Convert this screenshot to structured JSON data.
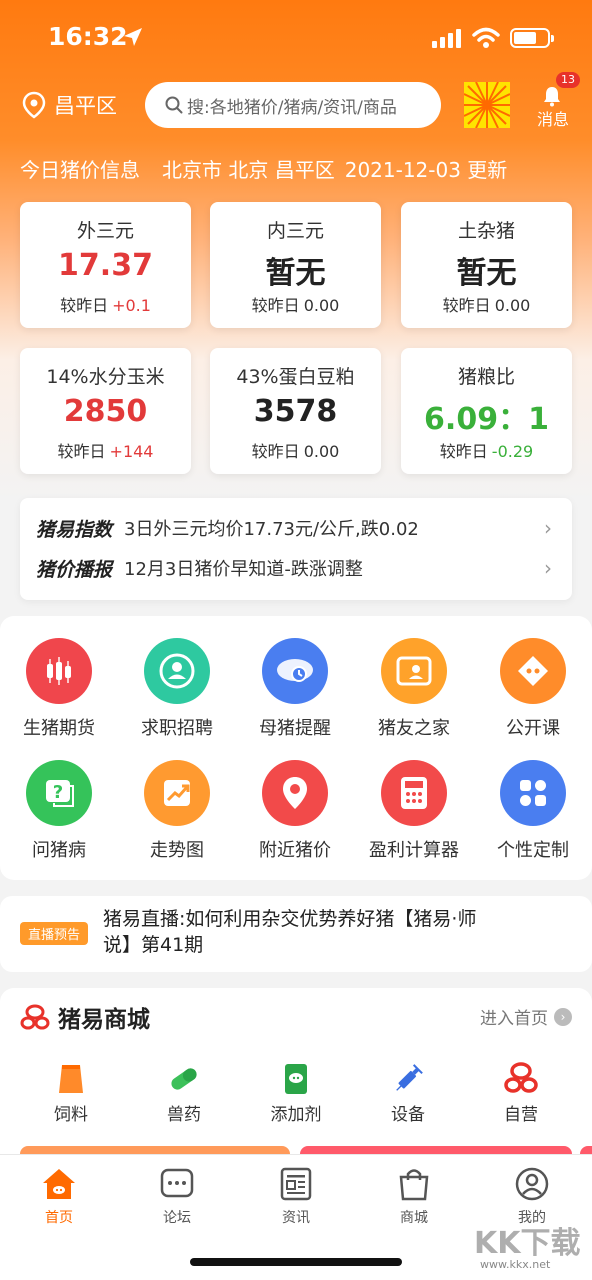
{
  "status_bar": {
    "time": "16:32"
  },
  "header": {
    "location": "昌平区",
    "search_placeholder": "搜:各地猪价/猪病/资讯/商品",
    "message_label": "消息",
    "message_badge": "13"
  },
  "price_info": {
    "title": "今日猪价信息",
    "region": "北京市 北京 昌平区",
    "updated": "2021-12-03 更新"
  },
  "price_cards": [
    {
      "title": "外三元",
      "value": "17.37",
      "cmp_label": "较昨日",
      "delta": "+0.1",
      "color": "red"
    },
    {
      "title": "内三元",
      "value": "暂无",
      "cmp_label": "较昨日",
      "delta": "0.00",
      "color": "normal"
    },
    {
      "title": "土杂猪",
      "value": "暂无",
      "cmp_label": "较昨日",
      "delta": "0.00",
      "color": "normal"
    },
    {
      "title": "14%水分玉米",
      "value": "2850",
      "cmp_label": "较昨日",
      "delta": "+144",
      "color": "red"
    },
    {
      "title": "43%蛋白豆粕",
      "value": "3578",
      "cmp_label": "较昨日",
      "delta": "0.00",
      "color": "normal"
    },
    {
      "title": "猪粮比",
      "value": "6.09：1",
      "cmp_label": "较昨日",
      "delta": "-0.29",
      "color": "green"
    }
  ],
  "news": [
    {
      "tag": "猪易指数",
      "text": "3日外三元均价17.73元/公斤,跌0.02"
    },
    {
      "tag": "猪价播报",
      "text": "12月3日猪价早知道-跌涨调整"
    }
  ],
  "grid_items": [
    {
      "label": "生猪期货",
      "icon": "candlestick-icon",
      "color": "#f0464c"
    },
    {
      "label": "求职招聘",
      "icon": "person-icon",
      "color": "#2ec9a0"
    },
    {
      "label": "母猪提醒",
      "icon": "sow-clock-icon",
      "color": "#4a7ef0"
    },
    {
      "label": "猪友之家",
      "icon": "profile-card-icon",
      "color": "#ffa22a"
    },
    {
      "label": "公开课",
      "icon": "chat-bubble-icon",
      "color": "#ff8c2a"
    },
    {
      "label": "问猪病",
      "icon": "question-icon",
      "color": "#35c35a"
    },
    {
      "label": "走势图",
      "icon": "trend-icon",
      "color": "#ff9a30"
    },
    {
      "label": "附近猪价",
      "icon": "map-pin-icon",
      "color": "#f24a4a"
    },
    {
      "label": "盈利计算器",
      "icon": "calculator-icon",
      "color": "#f24a4a"
    },
    {
      "label": "个性定制",
      "icon": "apps-icon",
      "color": "#4a7ef0"
    }
  ],
  "live": {
    "badge": "直播预告",
    "title": "猪易直播:如何利用杂交优势养好猪【猪易·师说】第41期"
  },
  "mall": {
    "title": "猪易商城",
    "more": "进入首页",
    "items": [
      {
        "label": "饲料",
        "icon": "feed-bag-icon"
      },
      {
        "label": "兽药",
        "icon": "pill-icon"
      },
      {
        "label": "添加剂",
        "icon": "additive-bag-icon"
      },
      {
        "label": "设备",
        "icon": "syringe-icon"
      },
      {
        "label": "自营",
        "icon": "logo-icon"
      }
    ]
  },
  "tabs": [
    {
      "label": "首页",
      "icon": "home-icon",
      "active": true
    },
    {
      "label": "论坛",
      "icon": "forum-icon",
      "active": false
    },
    {
      "label": "资讯",
      "icon": "news-icon",
      "active": false
    },
    {
      "label": "商城",
      "icon": "bag-icon",
      "active": false
    },
    {
      "label": "我的",
      "icon": "user-icon",
      "active": false
    }
  ],
  "watermark": {
    "text": "KK下载",
    "url": "www.kkx.net"
  },
  "colors": {
    "primary": "#ff7a10",
    "red": "#e23a3a",
    "green": "#3ab03a",
    "active_tab": "#ff6a00"
  }
}
